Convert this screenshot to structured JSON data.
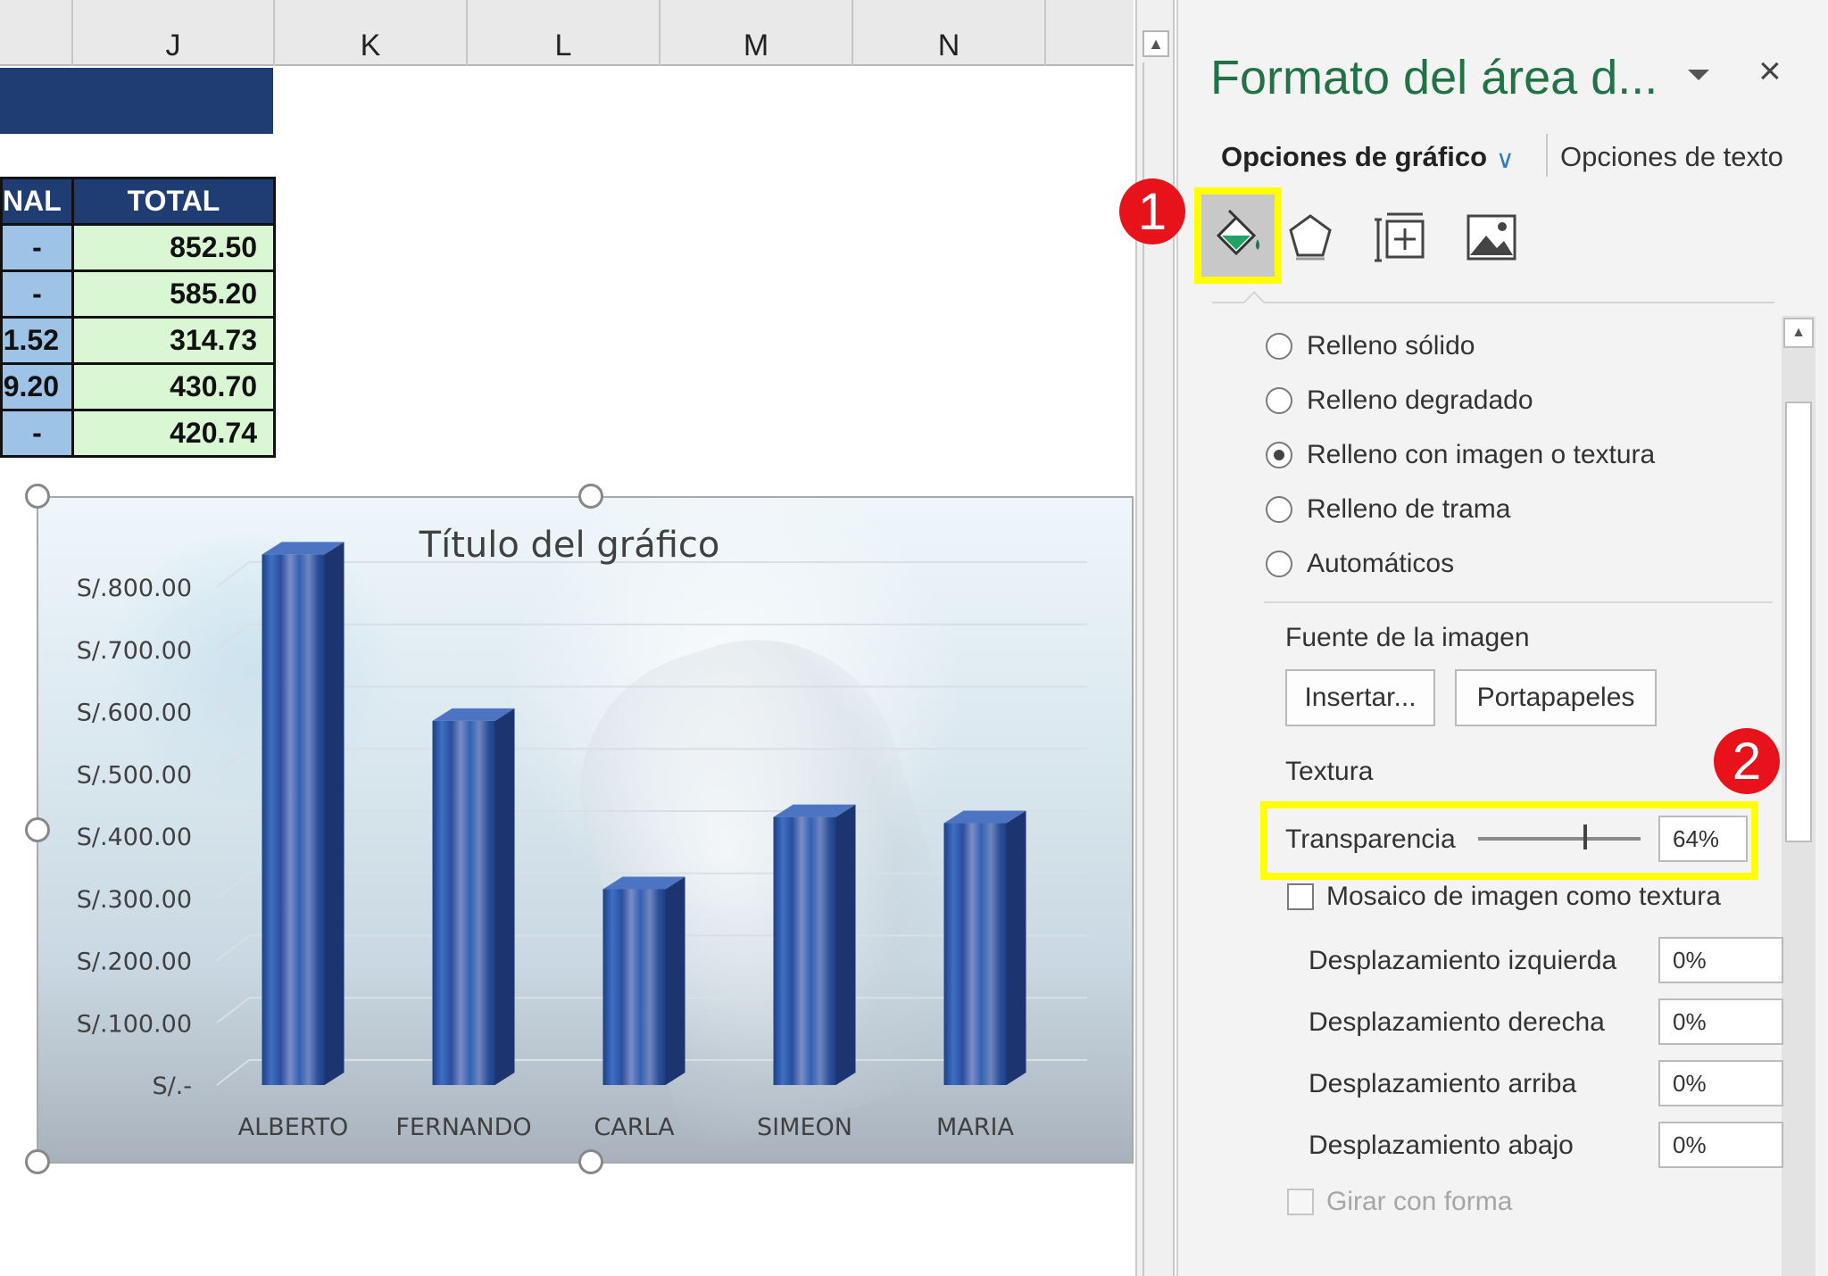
{
  "sheet": {
    "columns": [
      "J",
      "K",
      "L",
      "M",
      "N"
    ],
    "table": {
      "headers": [
        "NAL",
        "TOTAL"
      ],
      "rows": [
        [
          "-",
          "852.50"
        ],
        [
          "-",
          "585.20"
        ],
        [
          "1.52",
          "314.73"
        ],
        [
          "9.20",
          "430.70"
        ],
        [
          "-",
          "420.74"
        ]
      ]
    }
  },
  "chart_data": {
    "type": "bar",
    "title": "Título del gráfico",
    "categories": [
      "ALBERTO",
      "FERNANDO",
      "CARLA",
      "SIMEON",
      "MARIA"
    ],
    "values": [
      852.5,
      585.2,
      314.73,
      430.7,
      420.74
    ],
    "yticks": [
      "S/.-",
      "S/.100.00",
      "S/.200.00",
      "S/.300.00",
      "S/.400.00",
      "S/.500.00",
      "S/.600.00",
      "S/.700.00",
      "S/.800.00"
    ],
    "ylim": [
      0,
      800
    ],
    "grid": true,
    "legend": "none",
    "bar_color": "#3a66b0",
    "style": "3d-column"
  },
  "pane": {
    "title": "Formato del área d...",
    "close_glyph": "×",
    "tab_chart": "Opciones de gráfico",
    "tab_chart_chevron": "∨",
    "tab_text": "Opciones de texto",
    "icons": [
      "fill-line-icon",
      "effects-icon",
      "size-properties-icon",
      "picture-icon"
    ],
    "badge_1": "1",
    "badge_2": "2",
    "fill_options": [
      {
        "label": "Relleno sólido",
        "checked": false
      },
      {
        "label": "Relleno degradado",
        "checked": false
      },
      {
        "label": "Relleno con imagen o textura",
        "checked": true
      },
      {
        "label": "Relleno de trama",
        "checked": false
      },
      {
        "label": "Automáticos",
        "checked": false
      }
    ],
    "image_source_label": "Fuente de la imagen",
    "insert_button": "Insertar...",
    "clipboard_button": "Portapapeles",
    "texture_label": "Textura",
    "transparency_label": "Transparencia",
    "transparency_value": "64%",
    "transparency_level": 0.64,
    "tile_label": "Mosaico de imagen como textura",
    "offsets": [
      {
        "label": "Desplazamiento izquierda",
        "value": "0%"
      },
      {
        "label": "Desplazamiento derecha",
        "value": "0%"
      },
      {
        "label": "Desplazamiento arriba",
        "value": "0%"
      },
      {
        "label": "Desplazamiento abajo",
        "value": "0%"
      }
    ],
    "rotate_label": "Girar con forma",
    "accent_color": "#217346",
    "highlight_color": "#ffff00",
    "badge_color": "#e8121b"
  }
}
